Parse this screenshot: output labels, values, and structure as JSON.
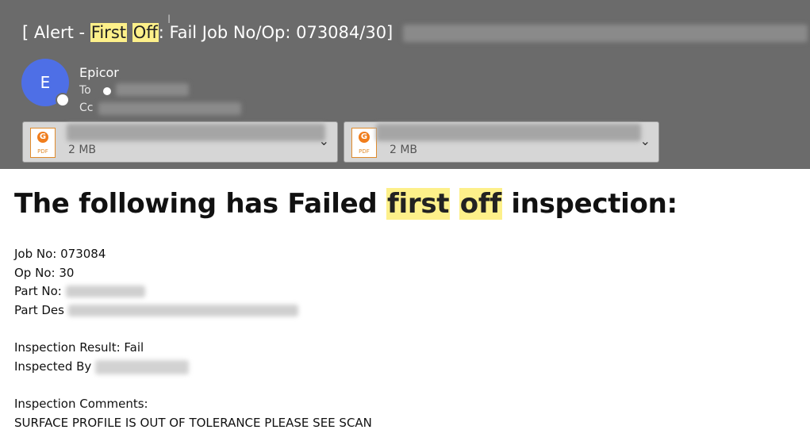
{
  "email": {
    "subject": {
      "prefix": "[ Alert - ",
      "hl1": "First",
      "space": " ",
      "hl2": "Off",
      "suffix": ": Fail Job No/Op: 073084/30]"
    },
    "sender": {
      "avatar_initial": "E",
      "name": "Epicor",
      "to_label": "To",
      "cc_label": "Cc"
    },
    "attachments": [
      {
        "size": "2 MB",
        "icon": "pdf-file-icon",
        "type": "PDF"
      },
      {
        "size": "2 MB",
        "icon": "pdf-file-icon",
        "type": "PDF"
      }
    ],
    "body": {
      "heading_pre": "The following has Failed ",
      "heading_hl1": "first",
      "heading_hl2": "off",
      "heading_post": " inspection:",
      "job_no": "Job No: 073084",
      "op_no": "Op No: 30",
      "part_no_label": "Part No:",
      "part_desc_label": "Part Des",
      "inspection_result": "Inspection Result: Fail",
      "inspected_by_label": "Inspected By",
      "comments_label": "Inspection Comments:",
      "comments": "SURFACE PROFILE IS OUT OF TOLERANCE PLEASE SEE SCAN"
    },
    "colors": {
      "header_bg": "#6b6b6b",
      "highlight": "#fdf08a",
      "avatar": "#4e6fe6"
    }
  }
}
